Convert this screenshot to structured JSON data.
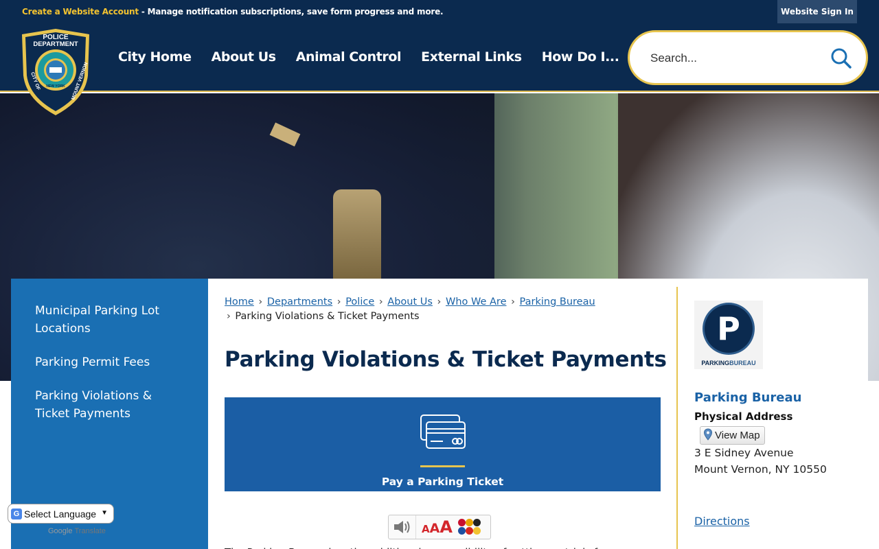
{
  "topbar": {
    "create_account_link": "Create a Website Account",
    "create_account_desc": " - Manage notification subscriptions, save form progress and more.",
    "sign_in": "Website Sign In"
  },
  "logo": {
    "line1": "POLICE",
    "line2": "DEPARTMENT",
    "ring_left": "CITY OF",
    "ring_right": "MOUNT VERNON",
    "state": "NEW YORK"
  },
  "nav": {
    "items": [
      "City Home",
      "About Us",
      "Animal Control",
      "External Links",
      "How Do I..."
    ]
  },
  "search": {
    "placeholder": "Search...",
    "icon": "search-icon"
  },
  "sidebar": {
    "items": [
      "Municipal Parking Lot Locations",
      "Parking Permit Fees",
      "Parking Violations & Ticket Payments"
    ]
  },
  "breadcrumb": {
    "links": [
      "Home",
      "Departments",
      "Police",
      "About Us",
      "Who We Are",
      "Parking Bureau"
    ],
    "current": "Parking Violations & Ticket Payments"
  },
  "page": {
    "title": "Parking Violations & Ticket Payments",
    "pay_tile_label": "Pay a Parking Ticket",
    "body_text": "The Parking Bureau has the additional responsibility of setting up trials for"
  },
  "readspeaker": {
    "text_size_label": "AAA"
  },
  "contact": {
    "logo_letter": "P",
    "logo_caption_1": "PARKING",
    "logo_caption_2": "BUREAU",
    "name": "Parking Bureau",
    "address_label": "Physical Address",
    "view_map": "View Map",
    "address_line1": "3 E Sidney Avenue",
    "address_line2": "Mount Vernon, NY 10550",
    "directions": "Directions"
  },
  "translate": {
    "select_label": "Select Language",
    "powered_google": "Google",
    "powered_translate": "Translate"
  },
  "colors": {
    "navy": "#0b2a4f",
    "gold": "#e7c44e",
    "sidebar_blue": "#1a6fb3",
    "tile_blue": "#1b5ea5",
    "link_blue": "#1a62a6"
  }
}
